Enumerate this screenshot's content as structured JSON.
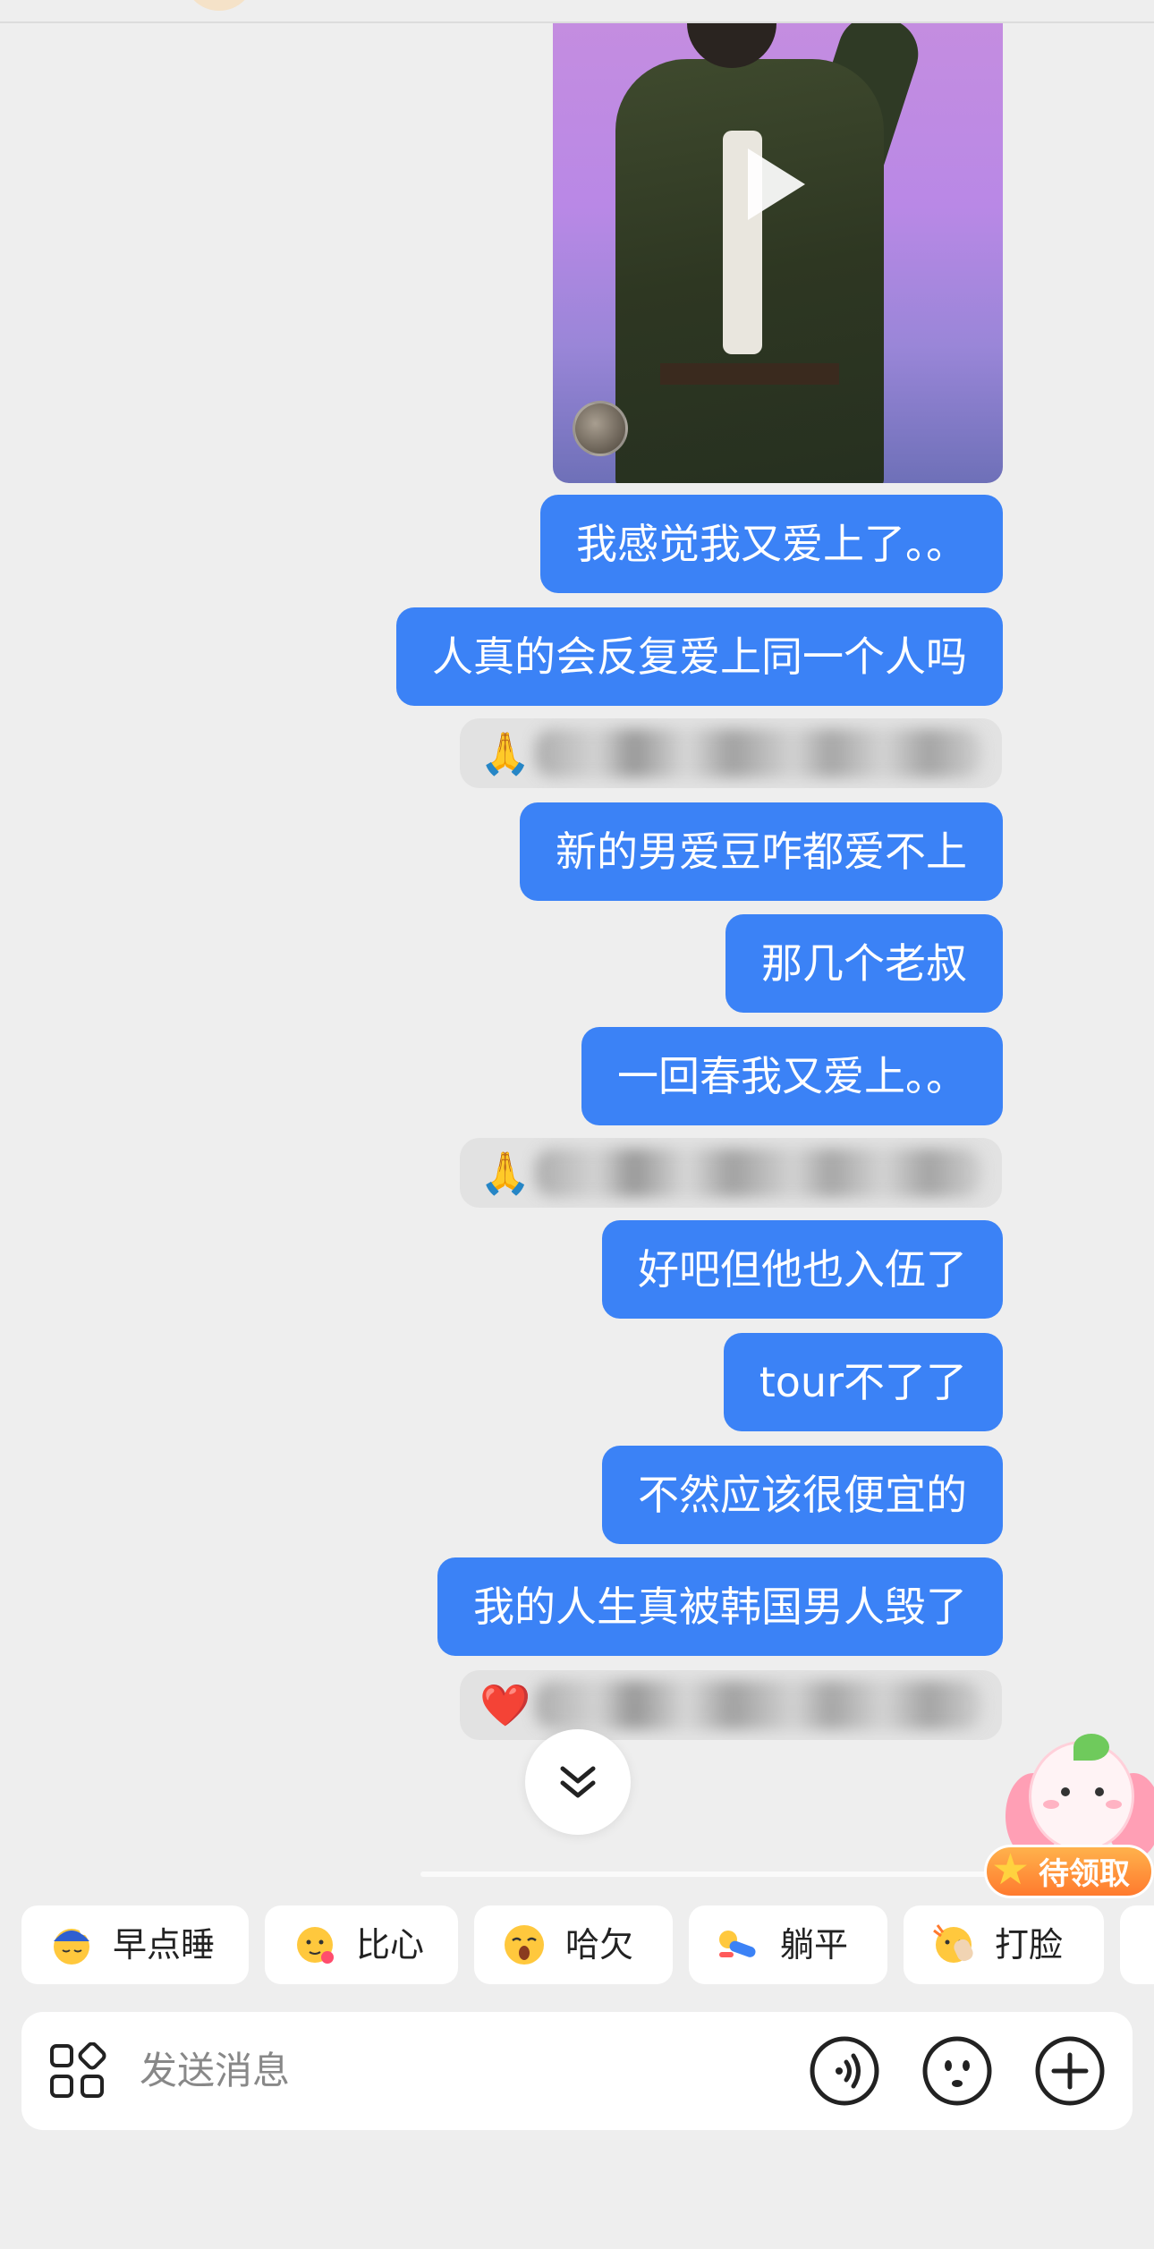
{
  "messages": [
    {
      "type": "text",
      "text": "我感觉我又爱上了。。"
    },
    {
      "type": "text",
      "text": "人真的会反复爱上同一个人吗"
    },
    {
      "type": "reaction",
      "icon": "🙏"
    },
    {
      "type": "text",
      "text": "新的男爱豆咋都爱不上"
    },
    {
      "type": "text",
      "text": "那几个老叔"
    },
    {
      "type": "text",
      "text": "一回春我又爱上。。"
    },
    {
      "type": "reaction",
      "icon": "🙏"
    },
    {
      "type": "text",
      "text": "好吧但他也入伍了"
    },
    {
      "type": "text",
      "text": "tour不了了"
    },
    {
      "type": "text",
      "text": "不然应该很便宜的"
    },
    {
      "type": "text",
      "text": "我的人生真被韩国男人毁了"
    },
    {
      "type": "reaction",
      "icon": "❤️"
    }
  ],
  "mascot": {
    "label": "待领取"
  },
  "quick_replies": [
    {
      "label": "早点睡",
      "icon": "sleep-emoji"
    },
    {
      "label": "比心",
      "icon": "heart-hands-emoji"
    },
    {
      "label": "哈欠",
      "icon": "yawn-emoji"
    },
    {
      "label": "躺平",
      "icon": "lie-flat-emoji"
    },
    {
      "label": "打脸",
      "icon": "face-slap-emoji"
    }
  ],
  "input": {
    "placeholder": "发送消息"
  },
  "colors": {
    "bubble": "#3b82f6",
    "background": "#eeeeee"
  }
}
